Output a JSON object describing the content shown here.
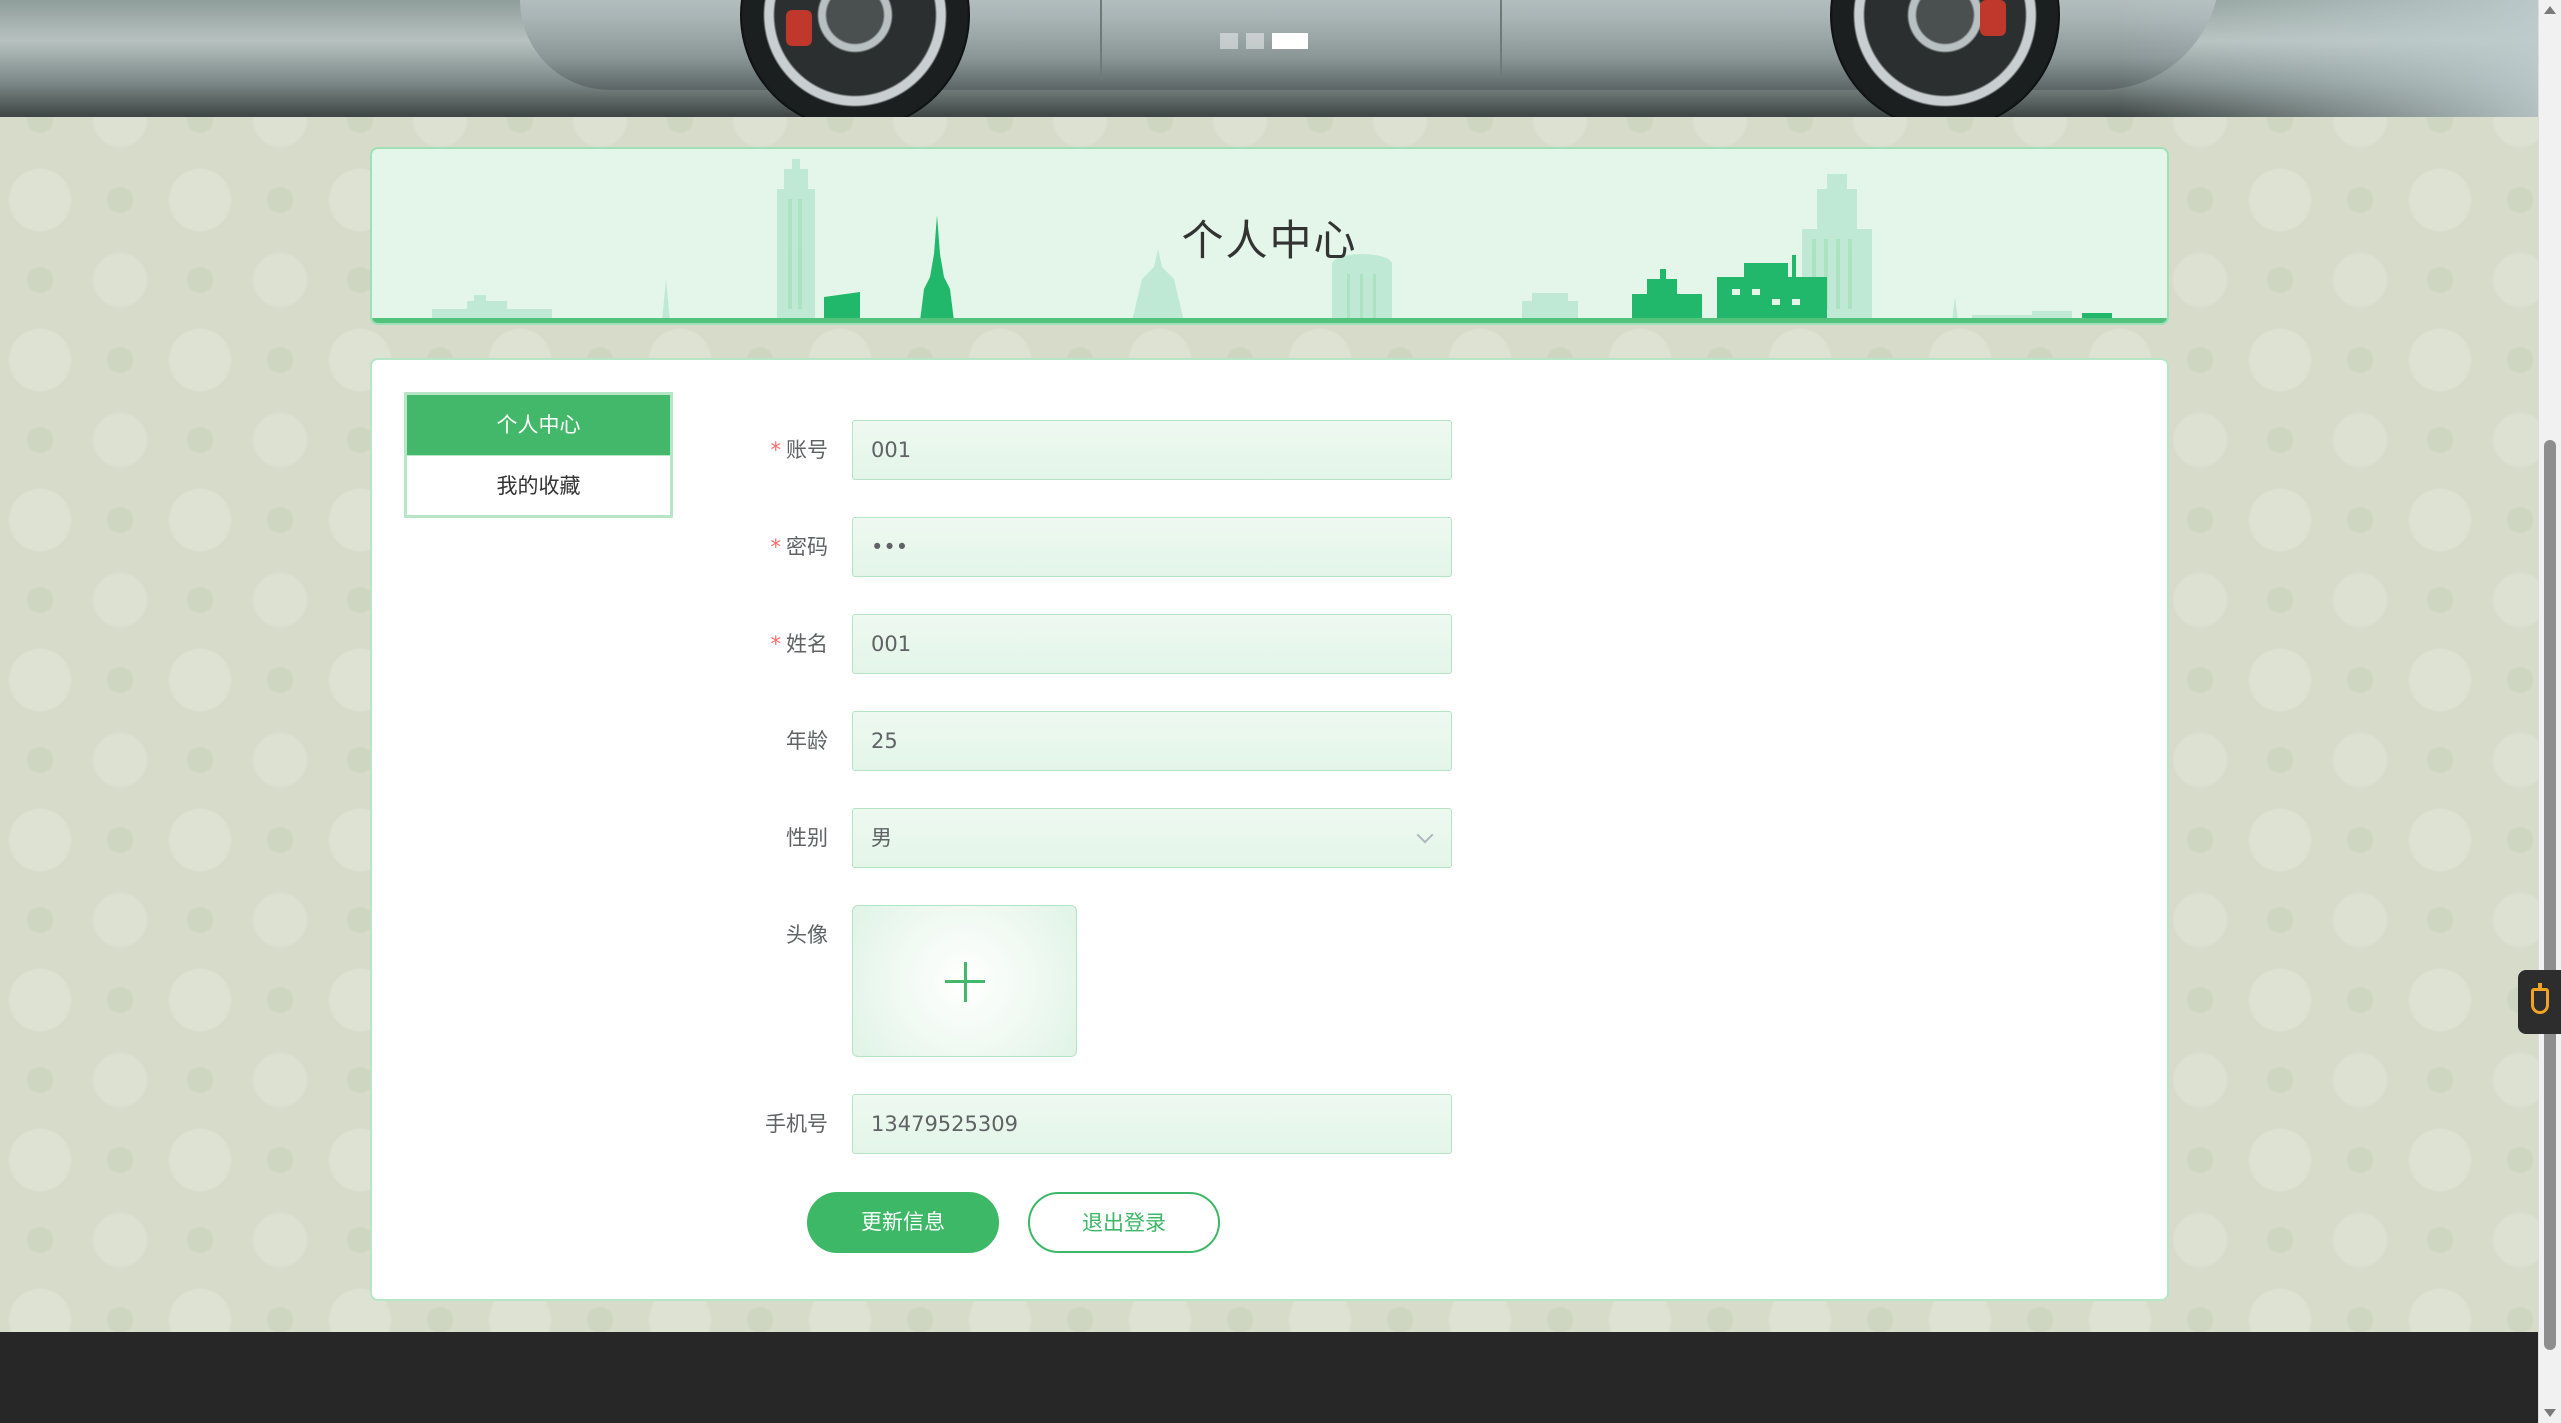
{
  "banner": {
    "slides_total": 3,
    "active_slide": 3
  },
  "header": {
    "title": "个人中心"
  },
  "sidebar": {
    "items": [
      {
        "label": "个人中心",
        "active": true
      },
      {
        "label": "我的收藏",
        "active": false
      }
    ]
  },
  "form": {
    "account": {
      "label": "账号",
      "required": "*",
      "value": "001"
    },
    "password": {
      "label": "密码",
      "required": "*",
      "value": "•••"
    },
    "name": {
      "label": "姓名",
      "required": "*",
      "value": "001"
    },
    "age": {
      "label": "年龄",
      "value": "25"
    },
    "gender": {
      "label": "性别",
      "value": "男"
    },
    "avatar": {
      "label": "头像",
      "icon": "plus-icon"
    },
    "phone": {
      "label": "手机号",
      "value": "13479525309"
    }
  },
  "actions": {
    "update_label": "更新信息",
    "logout_label": "退出登录"
  },
  "colors": {
    "accent": "#3db866",
    "page_bg": "#d6dcc9",
    "footer": "#272727",
    "required": "#f56c6c"
  }
}
